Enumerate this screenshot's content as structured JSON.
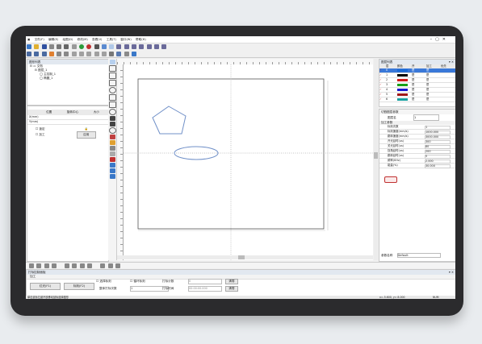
{
  "menu": [
    "文件(F)",
    "编辑(E)",
    "绘图(D)",
    "修改(M)",
    "查看(V)",
    "工具(T)",
    "窗口(W)",
    "帮助(H)"
  ],
  "tree": {
    "title": "图形列表",
    "root": "文档",
    "children": [
      "图层_1",
      "主控制_1",
      "椭圆_1"
    ]
  },
  "props": {
    "tabs": [
      "位置",
      "旋转中心",
      "大小"
    ],
    "labels": [
      "X(mm)",
      "Y(mm)"
    ],
    "lock": "锁定",
    "process": "加工",
    "apply": "应用"
  },
  "layers": {
    "title": "图层列表",
    "headers": [
      "层",
      "颜色",
      "开",
      "加工",
      "优先"
    ],
    "rows": [
      {
        "num": "0",
        "color": "#1a6ad6",
        "v": "是",
        "p": "是"
      },
      {
        "num": "1",
        "color": "#000000",
        "v": "是",
        "p": "是"
      },
      {
        "num": "2",
        "color": "#d01818",
        "v": "是",
        "p": "是"
      },
      {
        "num": "3",
        "color": "#18a018",
        "v": "是",
        "p": "是"
      },
      {
        "num": "4",
        "color": "#1818d0",
        "v": "是",
        "p": "是"
      },
      {
        "num": "5",
        "color": "#a01818",
        "v": "是",
        "p": "是"
      },
      {
        "num": "6",
        "color": "#18a0a0",
        "v": "是",
        "p": "是"
      }
    ]
  },
  "params": {
    "title": "切割图层参数",
    "number_label": "图层名",
    "number_value": "1",
    "sub": "加工参数",
    "rows": [
      {
        "k": "标刻次数",
        "v": "1"
      },
      {
        "k": "标刻速度(mm/s)",
        "v": "1000.000"
      },
      {
        "k": "跳转速度(mm/s)",
        "v": "3000.000"
      },
      {
        "k": "开光延时(us)",
        "v": "300"
      },
      {
        "k": "关光延时(us)",
        "v": "80"
      },
      {
        "k": "拐角延时(us)",
        "v": "200"
      },
      {
        "k": "跳转延时(us)",
        "v": "5"
      },
      {
        "k": "频率(KHz)",
        "v": "2.000"
      },
      {
        "k": "能量(%)",
        "v": "30.000"
      }
    ],
    "param_name_label": "参数名称",
    "param_name_value": "Default"
  },
  "control": {
    "title": "打标控制面板",
    "tab": "加工",
    "red": "红光(F1)",
    "mark": "标刻(F2)",
    "select_mark": "选择标刻",
    "continuous": "循环标刻",
    "count_label": "打标计数",
    "count_value": "0",
    "clear1": "清零",
    "total_label": "整体打标次数",
    "total_value": "1",
    "time_label": "打标时间",
    "time_value": "00:00:00.000",
    "clear2": "清零"
  },
  "status": {
    "left": "单击鼠标左键不放移动鼠标选择图形",
    "coords": "x=-5.600, y= 8.000",
    "mode": "NUM"
  }
}
